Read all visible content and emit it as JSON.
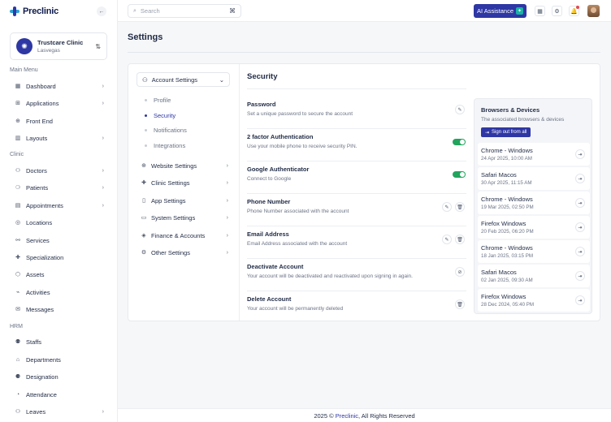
{
  "app": {
    "logo_text": "Preclinic"
  },
  "clinic": {
    "name": "Trustcare Clinic",
    "location": "Lasvegas",
    "switch_icon": "swap-icon"
  },
  "sidebar": {
    "sections": {
      "main": "Main Menu",
      "clinic": "Clinic",
      "hrm": "HRM"
    },
    "items": [
      {
        "label": "Dashboard",
        "icon": "grid-icon",
        "has_children": true
      },
      {
        "label": "Applications",
        "icon": "apps-icon",
        "has_children": true
      },
      {
        "label": "Front End",
        "icon": "globe-icon",
        "has_children": false
      },
      {
        "label": "Layouts",
        "icon": "layout-icon",
        "has_children": true
      },
      {
        "label": "Doctors",
        "icon": "user-icon",
        "has_children": true
      },
      {
        "label": "Patients",
        "icon": "patient-icon",
        "has_children": true
      },
      {
        "label": "Appointments",
        "icon": "calendar-icon",
        "has_children": true
      },
      {
        "label": "Locations",
        "icon": "pin-icon",
        "has_children": false
      },
      {
        "label": "Services",
        "icon": "services-icon",
        "has_children": false
      },
      {
        "label": "Specialization",
        "icon": "specialization-icon",
        "has_children": false
      },
      {
        "label": "Assets",
        "icon": "assets-icon",
        "has_children": false
      },
      {
        "label": "Activities",
        "icon": "activity-icon",
        "has_children": false
      },
      {
        "label": "Messages",
        "icon": "message-icon",
        "has_children": false
      },
      {
        "label": "Staffs",
        "icon": "staff-icon",
        "has_children": false
      },
      {
        "label": "Departments",
        "icon": "department-icon",
        "has_children": false
      },
      {
        "label": "Designation",
        "icon": "designation-icon",
        "has_children": false
      },
      {
        "label": "Attendance",
        "icon": "attendance-icon",
        "has_children": false
      },
      {
        "label": "Leaves",
        "icon": "leaves-icon",
        "has_children": true
      }
    ]
  },
  "topbar": {
    "search_placeholder": "Search",
    "search_shortcut": "⌘",
    "ai_label": "AI Assistance"
  },
  "page": {
    "title": "Settings"
  },
  "settings_nav": {
    "account_label": "Account Settings",
    "sub_items": [
      {
        "label": "Profile",
        "active": false
      },
      {
        "label": "Security",
        "active": true
      },
      {
        "label": "Notifications",
        "active": false
      },
      {
        "label": "Integrations",
        "active": false
      }
    ],
    "groups": [
      {
        "label": "Website Settings",
        "icon": "globe-icon"
      },
      {
        "label": "Clinic Settings",
        "icon": "clinic-icon"
      },
      {
        "label": "App Settings",
        "icon": "app-icon"
      },
      {
        "label": "System Settings",
        "icon": "system-icon"
      },
      {
        "label": "Finance & Accounts",
        "icon": "finance-icon"
      },
      {
        "label": "Other Settings",
        "icon": "settings-icon"
      }
    ]
  },
  "security": {
    "title": "Security",
    "rows": [
      {
        "name": "Password",
        "desc": "Set a unique password to secure the account",
        "actions": [
          "edit"
        ]
      },
      {
        "name": "2 factor Authentication",
        "desc": "Use your mobile phone to receive security PIN.",
        "actions": [
          "toggle"
        ]
      },
      {
        "name": "Google Authenticator",
        "desc": "Connect to Google",
        "actions": [
          "toggle"
        ]
      },
      {
        "name": "Phone Number",
        "desc": "Phone Number associated with the account",
        "actions": [
          "edit",
          "delete"
        ]
      },
      {
        "name": "Email Address",
        "desc": "Email Address associated with the account",
        "actions": [
          "edit",
          "delete"
        ]
      },
      {
        "name": "Deactivate Account",
        "desc": "Your account will be deactivated and reactivated upon signing in again.",
        "actions": [
          "block"
        ]
      },
      {
        "name": "Delete Account",
        "desc": "Your account will be permanently deleted",
        "actions": [
          "delete"
        ]
      }
    ]
  },
  "browsers": {
    "title": "Browsers & Devices",
    "subtitle": "The associated browsers & devices",
    "signout_all": "Sign out from all",
    "list": [
      {
        "name": "Chrome - Windows",
        "time": "24 Apr 2025, 10:00 AM"
      },
      {
        "name": "Safari Macos",
        "time": "30 Apr 2025, 11:15 AM"
      },
      {
        "name": "Chrome - Windows",
        "time": "19 Mar 2025, 02:50 PM"
      },
      {
        "name": "Firefox Windows",
        "time": "20 Feb 2025, 06:20 PM"
      },
      {
        "name": "Chrome - Windows",
        "time": "18 Jan 2025, 03:15 PM"
      },
      {
        "name": "Safari Macos",
        "time": "02 Jan 2025, 09:30 AM"
      },
      {
        "name": "Firefox Windows",
        "time": "28 Dec 2024, 05:40 PM"
      }
    ]
  },
  "footer": {
    "prefix": "2025 © ",
    "brand": "Preclinic",
    "suffix": ", All Rights Reserved"
  },
  "colors": {
    "primary": "#2e37a4",
    "success": "#22a45d",
    "accent": "#19b3a6"
  }
}
